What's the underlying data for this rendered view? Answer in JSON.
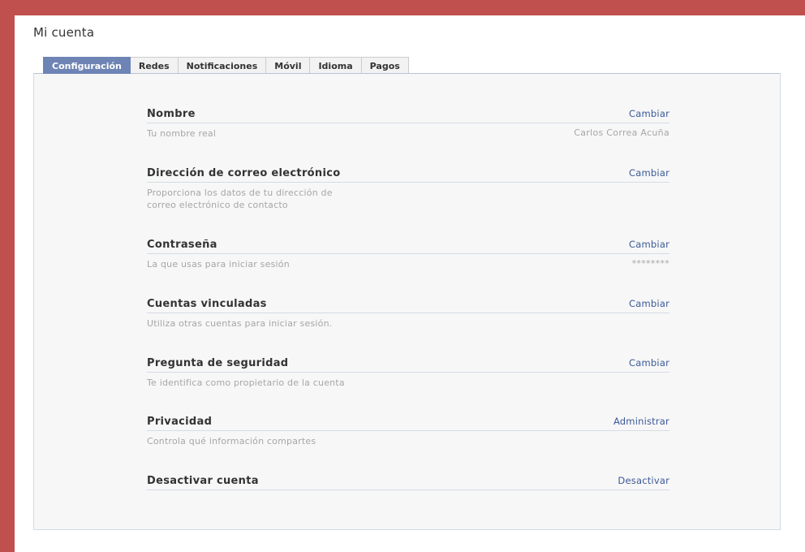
{
  "page": {
    "title": "Mi cuenta"
  },
  "tabs": [
    {
      "label": "Configuración",
      "active": true
    },
    {
      "label": "Redes",
      "active": false
    },
    {
      "label": "Notificaciones",
      "active": false
    },
    {
      "label": "Móvil",
      "active": false
    },
    {
      "label": "Idioma",
      "active": false
    },
    {
      "label": "Pagos",
      "active": false
    }
  ],
  "sections": [
    {
      "title": "Nombre",
      "action": "Cambiar",
      "description": "Tu nombre real",
      "value": "Carlos Correa Acuña"
    },
    {
      "title": "Dirección de correo electrónico",
      "action": "Cambiar",
      "description": "Proporciona los datos de tu dirección de\ncorreo electrónico de contacto",
      "value": ""
    },
    {
      "title": "Contraseña",
      "action": "Cambiar",
      "description": "La que usas para iniciar sesión",
      "value": "********"
    },
    {
      "title": "Cuentas vinculadas",
      "action": "Cambiar",
      "description": "Utiliza otras cuentas para iniciar sesión.",
      "value": ""
    },
    {
      "title": "Pregunta de seguridad",
      "action": "Cambiar",
      "description": "Te identifica como propietario de la cuenta",
      "value": ""
    },
    {
      "title": "Privacidad",
      "action": "Administrar",
      "description": "Controla qué información compartes",
      "value": ""
    },
    {
      "title": "Desactivar cuenta",
      "action": "Desactivar",
      "description": "",
      "value": ""
    }
  ],
  "colors": {
    "frame": "#c0504d",
    "active_tab": "#6d84b4",
    "link": "#3b5998"
  }
}
